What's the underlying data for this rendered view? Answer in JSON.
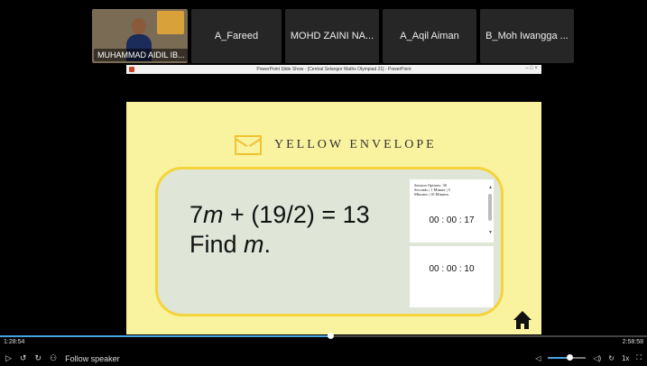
{
  "participants": [
    {
      "name": "MUHAMMAD AIDIL IB...",
      "video": true
    },
    {
      "name": "A_Fareed"
    },
    {
      "name": "MOHD ZAINI NA..."
    },
    {
      "name": "A_Aqil Aiman"
    },
    {
      "name": "B_Moh Iwangga ..."
    }
  ],
  "ppt": {
    "title": "PowerPoint Slide Show - [Central Selangor Maths Olympiad 21] - PowerPoint",
    "controls": "–  □  ×"
  },
  "slide": {
    "brand": "YELLOW ENVELOPE",
    "question_line1_pre": "7",
    "question_line1_var": "m",
    "question_line1_post": " + (19/2) = 13",
    "question_line2_pre": "Find ",
    "question_line2_var": "m",
    "question_line2_post": ".",
    "timer_options": [
      "Session Options: 30",
      "Seconds | 1 Minute | 5",
      "Minutes | 10 Minutes"
    ],
    "timer1": "00 : 00 : 17",
    "timer2": "00 : 00 : 10"
  },
  "player": {
    "elapsed": "1:28:54",
    "total": "2:58:58",
    "progress": 0.51,
    "volume": 0.55,
    "follow_label": "Follow speaker",
    "speed": "1x"
  },
  "colors": {
    "slide_bg": "#f9f29e",
    "accent": "#f5d33a",
    "progress": "#4aa3df"
  }
}
